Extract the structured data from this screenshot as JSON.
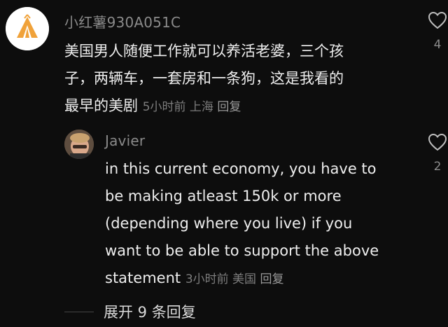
{
  "comment": {
    "username": "小红薯930A051C",
    "lines": [
      "美国男人随便工作就可以养活老婆，三个孩",
      "子，两辆车，一套房和一条狗，这是我看的",
      "最早的美剧"
    ],
    "time": "5小时前",
    "location": "上海",
    "reply_label": "回复",
    "like_count": "4"
  },
  "reply": {
    "username": "Javier",
    "lines": [
      "in this current economy, you have to",
      "be making atleast 150k or more",
      "(depending where you live) if you",
      "want to be able to support the above",
      "statement"
    ],
    "time": "3小时前",
    "location": "美国",
    "reply_label": "回复",
    "like_count": "2"
  },
  "expand_label": "展开 9 条回复",
  "colors": {
    "background": "#0d0d0d",
    "avatar_orange": "#f0a23a",
    "text": "#ececec",
    "muted": "#8a8a8a"
  }
}
